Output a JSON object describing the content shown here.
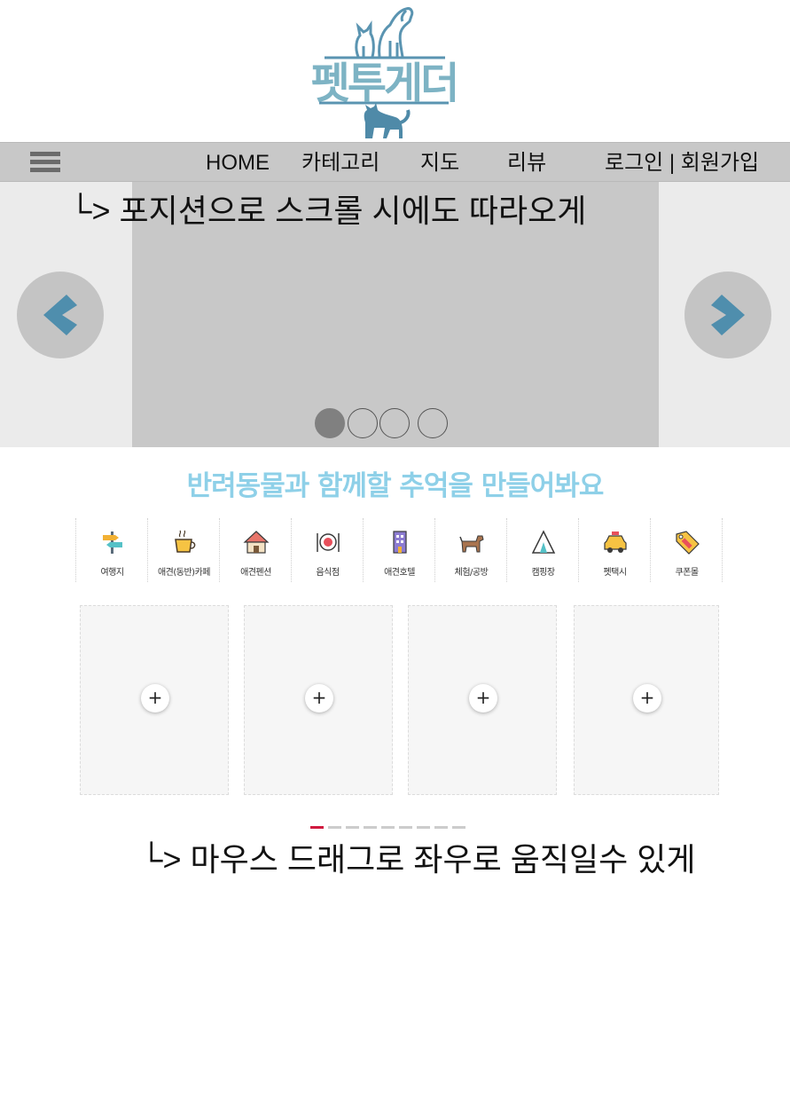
{
  "brand": {
    "name": "펫투게더",
    "primary_color": "#5a94b1",
    "light_color": "#7db3c4"
  },
  "nav": {
    "menu_icon": "hamburger-icon",
    "items": [
      {
        "label": "HOME"
      },
      {
        "label": "카테고리"
      },
      {
        "label": "지도"
      },
      {
        "label": "리뷰"
      }
    ],
    "auth": "로그인 | 회원가입"
  },
  "slider": {
    "note": "└> 포지션으로 스크롤 시에도 따라오게",
    "prev_icon": "chevron-left-icon",
    "next_icon": "chevron-right-icon",
    "dot_count": 4,
    "active_dot": 1
  },
  "headline": "반려동물과 함께할 추억을 만들어봐요",
  "categories": [
    {
      "label": "여행지",
      "icon": "signpost-icon"
    },
    {
      "label": "애견(동반)카페",
      "icon": "coffee-cup-icon"
    },
    {
      "label": "애견펜션",
      "icon": "house-icon"
    },
    {
      "label": "음식점",
      "icon": "plate-cutlery-icon"
    },
    {
      "label": "애견호텔",
      "icon": "hotel-building-icon"
    },
    {
      "label": "체험/공방",
      "icon": "dog-icon"
    },
    {
      "label": "캠핑장",
      "icon": "tent-icon"
    },
    {
      "label": "펫택시",
      "icon": "taxi-icon"
    },
    {
      "label": "쿠폰몰",
      "icon": "sale-tag-icon"
    }
  ],
  "cards": [
    {
      "button": "+"
    },
    {
      "button": "+"
    },
    {
      "button": "+"
    },
    {
      "button": "+"
    }
  ],
  "pager": {
    "count": 9,
    "active": 1,
    "active_color": "#d0193f"
  },
  "drag_note": "└> 마우스 드래그로 좌우로 움직일수 있게"
}
